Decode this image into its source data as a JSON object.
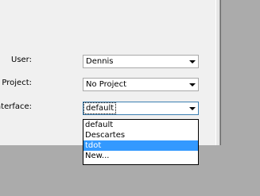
{
  "form": {
    "user": {
      "label": "User:",
      "value": "Dennis"
    },
    "project": {
      "label": "Project:",
      "value": "No Project"
    },
    "interface": {
      "label": "Interface:",
      "value": "default",
      "options": [
        "default",
        "Descartes",
        "tdot",
        "New..."
      ],
      "highlighted_option": "tdot"
    }
  },
  "colors": {
    "panel_background": "#f0f0f0",
    "window_background": "#ababab",
    "highlight": "#3399ff"
  },
  "icons": {
    "dropdown_arrow": "chevron-down-icon"
  }
}
